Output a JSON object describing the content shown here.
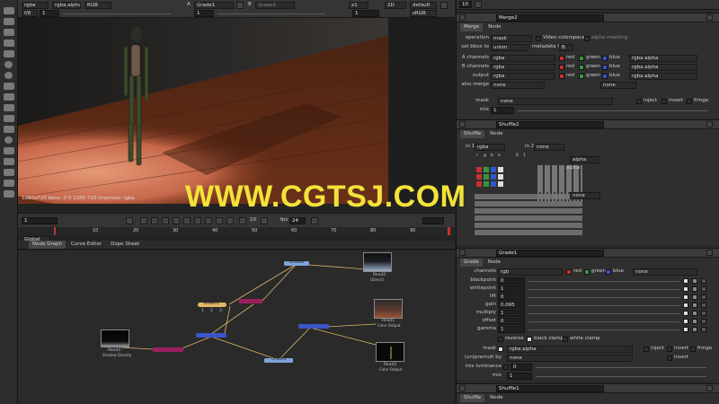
{
  "viewer": {
    "layer": "rgba",
    "channel": "rgba.alpha",
    "display": "RGB",
    "a_label": "A",
    "a_input": "Grade1",
    "b_label": "B",
    "b_input": "Grade1",
    "zoom": "x1",
    "mode": "2D",
    "lut": "default",
    "colorspace": "sRGB",
    "fstop": "f/8",
    "frame_field": "1",
    "y_field": "1",
    "gain": "1",
    "status": "1280x720 bbox: 0 0 1280 720 channels: rgba",
    "timeline_frame": "1",
    "fps_label": "fps",
    "fps_value": "24",
    "step": "10",
    "ruler": [
      "10",
      "20",
      "30",
      "40",
      "50",
      "60",
      "70",
      "80",
      "90"
    ],
    "global": "Global"
  },
  "watermark": "WWW.CGTSJ.COM",
  "tabs": {
    "node_graph": "Node Graph",
    "curve_editor": "Curve Editor",
    "dope_sheet": "Dope Sheet"
  },
  "graph": {
    "nodes": {
      "grade2": "Grade2",
      "viewer1": "Viewer1",
      "grade1": "Grade1",
      "read2": "Read2",
      "read2_sub": "(Direct)",
      "read1": "Read1",
      "read1_sub": "Color Output",
      "read4": "Read4",
      "read4_sub": "Shadow Density",
      "read3": "Read3",
      "read3_sub": "Color Output"
    },
    "viewer_inputs": [
      "1",
      "2",
      "3"
    ]
  },
  "props": {
    "panel_count": "10",
    "merge": {
      "title": "Merge2",
      "tabs": [
        "Merge",
        "Node"
      ],
      "operation_label": "operation",
      "operation": "mask",
      "video_colorspace": "Video colorspace",
      "alpha_masking": "alpha masking",
      "bbox_label": "set bbox to",
      "bbox": "union",
      "metadata_label": "metadata from",
      "metadata": "B",
      "rows": [
        {
          "label": "A channels",
          "value": "rgba",
          "alpha": "rgba.alpha"
        },
        {
          "label": "B channels",
          "value": "rgba",
          "alpha": "rgba.alpha"
        },
        {
          "label": "output",
          "value": "rgba",
          "alpha": "rgba.alpha"
        }
      ],
      "red": "red",
      "green": "green",
      "blue": "blue",
      "also_merge_label": "also merge",
      "also_merge": "none",
      "also_merge_2": "none",
      "mask_label": "mask",
      "mask": "none",
      "inject": "inject",
      "invert": "invert",
      "fringe": "fringe",
      "mix_label": "mix",
      "mix": "1"
    },
    "shuffle": {
      "title": "Shuffle2",
      "tabs": [
        "Shuffle",
        "Node"
      ],
      "in1_label": "in 1",
      "in1": "rgba",
      "in2_label": "in 2",
      "in2": "none",
      "out1": "alpha",
      "out1_arrow": "alpha",
      "out2": "none",
      "cols": [
        "r",
        "g",
        "b",
        "a",
        "0",
        "1"
      ]
    },
    "grade": {
      "title": "Grade1",
      "tabs": [
        "Grade",
        "Node"
      ],
      "channels_label": "channels",
      "channels": "rgb",
      "red": "red",
      "green": "green",
      "blue": "blue",
      "none": "none",
      "rows": [
        {
          "label": "blackpoint",
          "value": "0"
        },
        {
          "label": "whitepoint",
          "value": "1"
        },
        {
          "label": "lift",
          "value": "0"
        },
        {
          "label": "gain",
          "value": "0.095"
        },
        {
          "label": "multiply",
          "value": "1"
        },
        {
          "label": "offset",
          "value": "0"
        },
        {
          "label": "gamma",
          "value": "1"
        }
      ],
      "reverse": "reverse",
      "black_clamp": "black clamp",
      "white_clamp": "white clamp",
      "mask_label": "mask",
      "mask": "rgba.alpha",
      "inject": "inject",
      "invert": "invert",
      "fringe": "fringe",
      "unpremult_label": "(un)premult by",
      "unpremult": "none",
      "invert2": "invert",
      "mix_lum_label": "mix luminance",
      "mix_lum": "0",
      "mix_label": "mix",
      "mix": "1"
    },
    "shuffle1": {
      "title": "Shuffle1",
      "tabs": [
        "Shuffle",
        "Node"
      ]
    }
  },
  "colors": {
    "accent_red": "#c83030",
    "node_blue": "#3b56c8",
    "node_magenta": "#9a1f5e",
    "node_viewer": "#e3b868",
    "node_grade_light": "#7ea4d8",
    "watermark": "#f2e23a"
  }
}
